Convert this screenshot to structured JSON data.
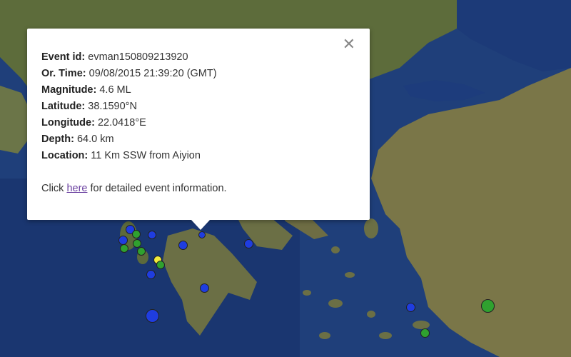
{
  "popup": {
    "rows": [
      {
        "label": "Event id:",
        "value": "evman150809213920"
      },
      {
        "label": "Or. Time:",
        "value": "09/08/2015  21:39:20 (GMT)"
      },
      {
        "label": "Magnitude:",
        "value": "4.6 ML"
      },
      {
        "label": "Latitude:",
        "value": "38.1590°N"
      },
      {
        "label": "Longitude:",
        "value": "22.0418°E"
      },
      {
        "label": "Depth:",
        "value": "64.0 km"
      },
      {
        "label": "Location:",
        "value": "11 Km SSW from Aiyion"
      }
    ],
    "footer_prefix": "Click",
    "footer_link": "here",
    "footer_suffix": "for detailed event information.",
    "close_icon": "close-icon"
  },
  "map": {
    "sea_color": "#1f3f7a",
    "land_color": "#5b6a3a",
    "marker_colors": {
      "blue": "#1f3de0",
      "green": "#2fa12f",
      "yellow": "#f2ea3c"
    }
  }
}
